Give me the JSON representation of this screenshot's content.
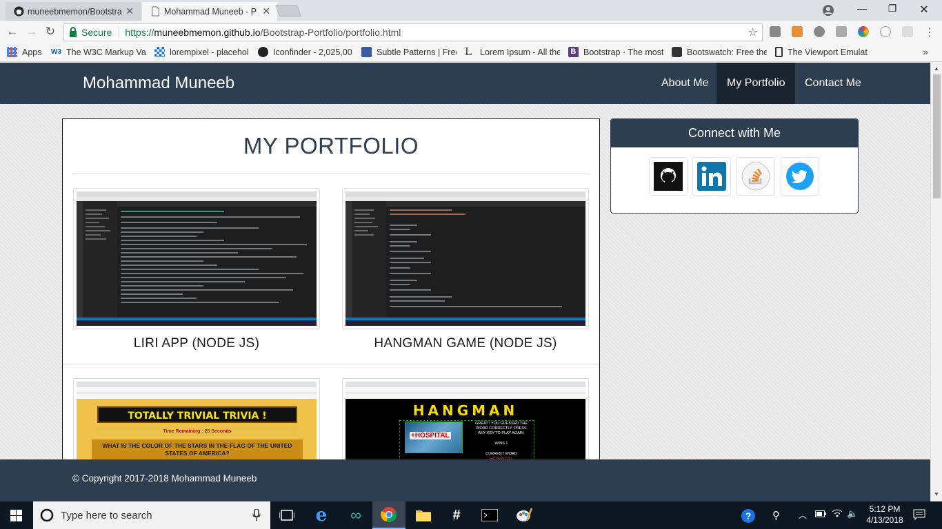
{
  "browser": {
    "tabs": [
      {
        "title": "muneebmemon/Bootstra",
        "active": false
      },
      {
        "title": "Mohammad Muneeb - P",
        "active": true
      }
    ],
    "secure_label": "Secure",
    "url_scheme": "https://",
    "url_host": "muneebmemon.github.io",
    "url_path": "/Bootstrap-Portfolio/portfolio.html",
    "bookmarks": [
      "Apps",
      "The W3C Markup Val",
      "lorempixel - placehol",
      "Iconfinder - 2,025,00",
      "Subtle Patterns | Free",
      "Lorem Ipsum - All the",
      "Bootstrap · The most",
      "Bootswatch: Free the",
      "The Viewport Emulat"
    ]
  },
  "site": {
    "brand": "Mohammad Muneeb",
    "nav": [
      {
        "label": "About Me",
        "active": false
      },
      {
        "label": "My Portfolio",
        "active": true
      },
      {
        "label": "Contact Me",
        "active": false
      }
    ],
    "portfolio_title": "MY PORTFOLIO",
    "projects": [
      {
        "caption": "LIRI APP (NODE JS)"
      },
      {
        "caption": "HANGMAN GAME (NODE JS)"
      },
      {
        "caption": ""
      },
      {
        "caption": ""
      }
    ],
    "trivia": {
      "title": "TOTALLY TRIVIAL TRIVIA !",
      "time": "Time Remaining : 25 Seconds",
      "question": "WHAT IS THE COLOR OF THE STARS IN THE FLAG OF THE UNITED STATES OF AMERICA?"
    },
    "hangman": {
      "title": "HANGMAN",
      "message": "GREAT ! YOU GUESSED THE WORD CORRECTLY. PRESS ANY KEY TO PLAY AGAIN.",
      "wins": "WINS 1",
      "current_word_label": "CURRENT WORD",
      "current_word": "HOSPITAL",
      "image_text": "+HOSPITAL"
    },
    "connect": {
      "heading": "Connect with Me",
      "socials": [
        "github-icon",
        "linkedin-icon",
        "stackoverflow-icon",
        "twitter-icon"
      ]
    },
    "footer": "© Copyright 2017-2018 Mohammad Muneeb"
  },
  "taskbar": {
    "search_placeholder": "Type here to search",
    "time": "5:12 PM",
    "date": "4/13/2018"
  },
  "colors": {
    "navbar": "#2c3e50",
    "navbar_active": "#1a242f",
    "secure_green": "#0b8043"
  }
}
